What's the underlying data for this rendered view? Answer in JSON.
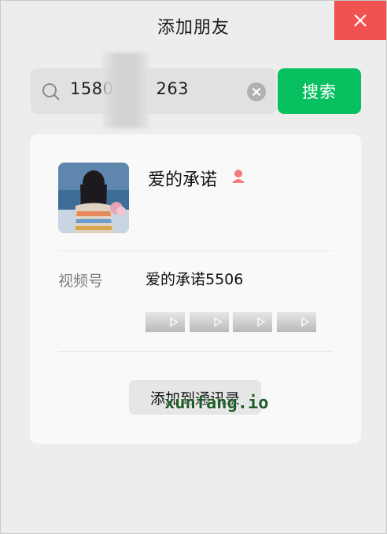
{
  "window": {
    "title": "添加朋友"
  },
  "search": {
    "query_left": "1580",
    "query_right": "263"
  },
  "search_button": {
    "label": "搜索"
  },
  "profile": {
    "name": "爱的承诺",
    "gender_icon": "female-user-icon",
    "gender_color": "#f07c7c"
  },
  "channels": {
    "label": "视频号",
    "value": "爱的承诺5506",
    "thumbnails": [
      "play-icon",
      "play-icon",
      "play-icon",
      "play-icon"
    ]
  },
  "actions": {
    "add_contact_label": "添加到通讯录"
  },
  "watermark": {
    "text": "xunfang.io"
  },
  "colors": {
    "accent": "#07c160",
    "close": "#f05252"
  }
}
